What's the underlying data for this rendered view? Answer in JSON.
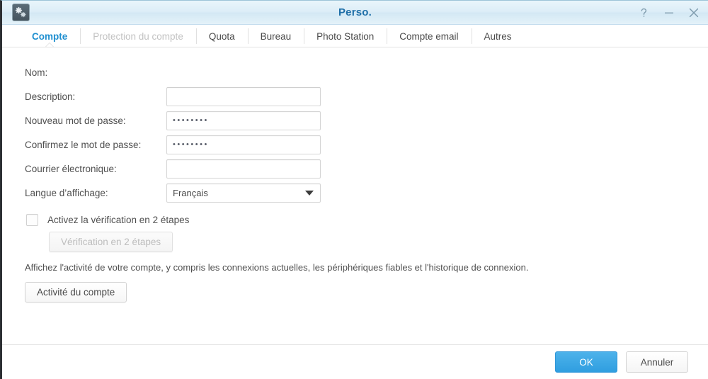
{
  "window": {
    "title": "Perso.",
    "icon": "control-panel-gears-icon",
    "controls": [
      {
        "name": "help-button",
        "glyph": "?"
      },
      {
        "name": "minimize-button",
        "glyph": "–"
      },
      {
        "name": "close-button",
        "glyph": "×"
      }
    ]
  },
  "tabs": [
    {
      "label": "Compte",
      "state": "active"
    },
    {
      "label": "Protection du compte",
      "state": "disabled"
    },
    {
      "label": "Quota",
      "state": "normal"
    },
    {
      "label": "Bureau",
      "state": "normal"
    },
    {
      "label": "Photo Station",
      "state": "normal"
    },
    {
      "label": "Compte email",
      "state": "normal"
    },
    {
      "label": "Autres",
      "state": "normal"
    }
  ],
  "form": {
    "name": {
      "label": "Nom:",
      "value": ""
    },
    "description": {
      "label": "Description:",
      "value": "",
      "placeholder": ""
    },
    "new_password": {
      "label": "Nouveau mot de passe:",
      "value": "••••••••"
    },
    "confirm_password": {
      "label": "Confirmez le mot de passe:",
      "value": "••••••••"
    },
    "email": {
      "label": "Courrier électronique:",
      "value": "",
      "placeholder": ""
    },
    "language": {
      "label": "Langue d’affichage:",
      "selected": "Français",
      "arrow_icon": "chevron-down-icon"
    }
  },
  "two_step": {
    "checkbox_label": "Activez la vérification en 2 étapes",
    "checked": false,
    "button_label": "Vérification en 2 étapes",
    "button_disabled": true
  },
  "activity": {
    "description": "Affichez l'activité de votre compte, y compris les connexions actuelles, les périphériques fiables et l'historique de connexion.",
    "button_label": "Activité du compte"
  },
  "footer": {
    "ok_label": "OK",
    "cancel_label": "Annuler"
  },
  "colors": {
    "accent": "#1f8fd0",
    "title_text": "#1f6fa8",
    "primary_button": "#2f9ee0",
    "disabled_text": "#c2c2c2"
  }
}
